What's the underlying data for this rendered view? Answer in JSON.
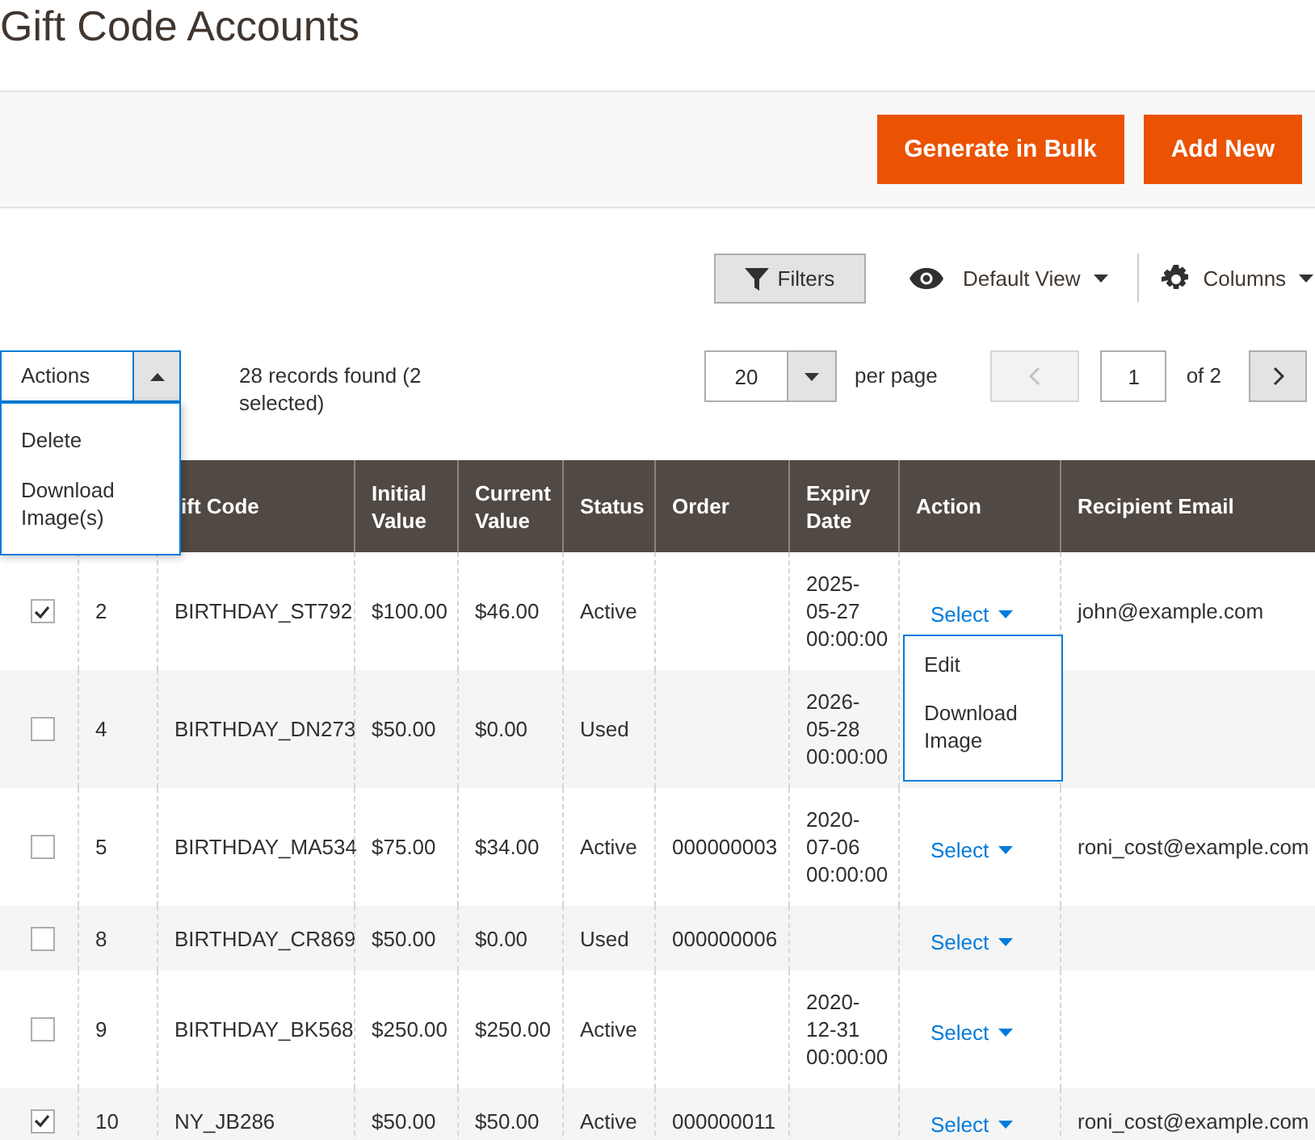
{
  "title": "Gift Code Accounts",
  "header_buttons": [
    "Generate in Bulk",
    "Add New"
  ],
  "toolbar": {
    "filters": "Filters",
    "view": "Default View",
    "columns": "Columns"
  },
  "mass_actions": {
    "label": "Actions",
    "expanded": true,
    "items": [
      "Delete",
      "Download Image(s)"
    ]
  },
  "records_text": "28 records found (2 selected)",
  "pagination": {
    "per_page": "20",
    "per_page_label": "per page",
    "prev_disabled": true,
    "page": "1",
    "of": "of 2",
    "next_disabled": false
  },
  "table": {
    "columns": [
      "ift Code",
      "Initial Value",
      "Current Value",
      "Status",
      "Order",
      "Expiry Date",
      "Action",
      "Recipient Email"
    ],
    "rows": [
      {
        "checked": true,
        "id": "2",
        "gift_code": "BIRTHDAY_ST792",
        "initial_value": "$100.00",
        "current_value": "$46.00",
        "status": "Active",
        "expiry_date": "2025-05-27 00:00:00",
        "action": "Select",
        "action_expanded": true,
        "action_items": [
          "Edit",
          "Download Image"
        ],
        "recipient_email": "john@example.com"
      },
      {
        "checked": false,
        "id": "4",
        "gift_code": "BIRTHDAY_DN273",
        "initial_value": "$50.00",
        "current_value": "$0.00",
        "status": "Used",
        "expiry_date": "2026-05-28 00:00:00"
      },
      {
        "checked": false,
        "id": "5",
        "gift_code": "BIRTHDAY_MA534",
        "initial_value": "$75.00",
        "current_value": "$34.00",
        "status": "Active",
        "order": "000000003",
        "expiry_date": "2020-07-06 00:00:00",
        "action": "Select",
        "recipient_email": "roni_cost@example.com"
      },
      {
        "checked": false,
        "id": "8",
        "gift_code": "BIRTHDAY_CR869",
        "initial_value": "$50.00",
        "current_value": "$0.00",
        "status": "Used",
        "order": "000000006",
        "action": "Select"
      },
      {
        "checked": false,
        "id": "9",
        "gift_code": "BIRTHDAY_BK568",
        "initial_value": "$250.00",
        "current_value": "$250.00",
        "status": "Active",
        "expiry_date": "2020-12-31 00:00:00",
        "action": "Select"
      },
      {
        "checked": true,
        "id": "10",
        "gift_code": "NY_JB286",
        "initial_value": "$50.00",
        "current_value": "$50.00",
        "status": "Active",
        "order": "000000011",
        "action": "Select",
        "recipient_email": "roni_cost@example.com"
      }
    ]
  }
}
